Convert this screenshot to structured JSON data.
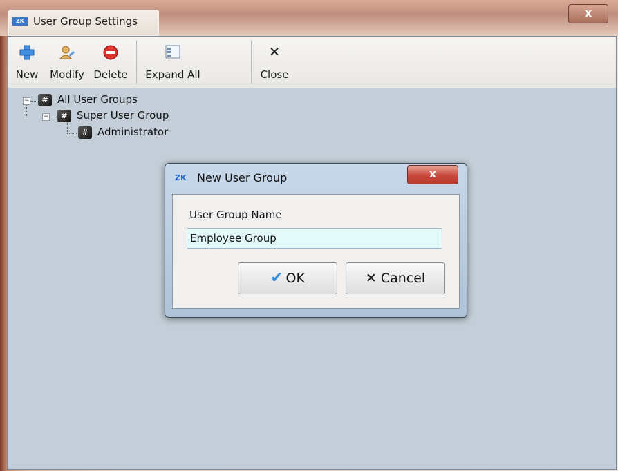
{
  "window": {
    "title": "User Group Settings",
    "close_glyph": "x",
    "logo": "ZK"
  },
  "toolbar": {
    "new": "New",
    "modify": "Modify",
    "delete": "Delete",
    "expand_all": "Expand All",
    "close": "Close",
    "close_glyph": "✕"
  },
  "tree": {
    "root": "All User Groups",
    "child": "Super User Group",
    "leaf": "Administrator"
  },
  "dialog": {
    "logo": "ZK",
    "title": "New User Group",
    "close_glyph": "x",
    "field_label": "User Group Name",
    "field_value": "Employee Group",
    "ok_label": "OK",
    "cancel_label": "Cancel",
    "cancel_glyph": "✕"
  },
  "colors": {
    "client_bg": "#c3ced8",
    "input_bg": "#e4fbfb",
    "accent": "#3a8fd8"
  }
}
